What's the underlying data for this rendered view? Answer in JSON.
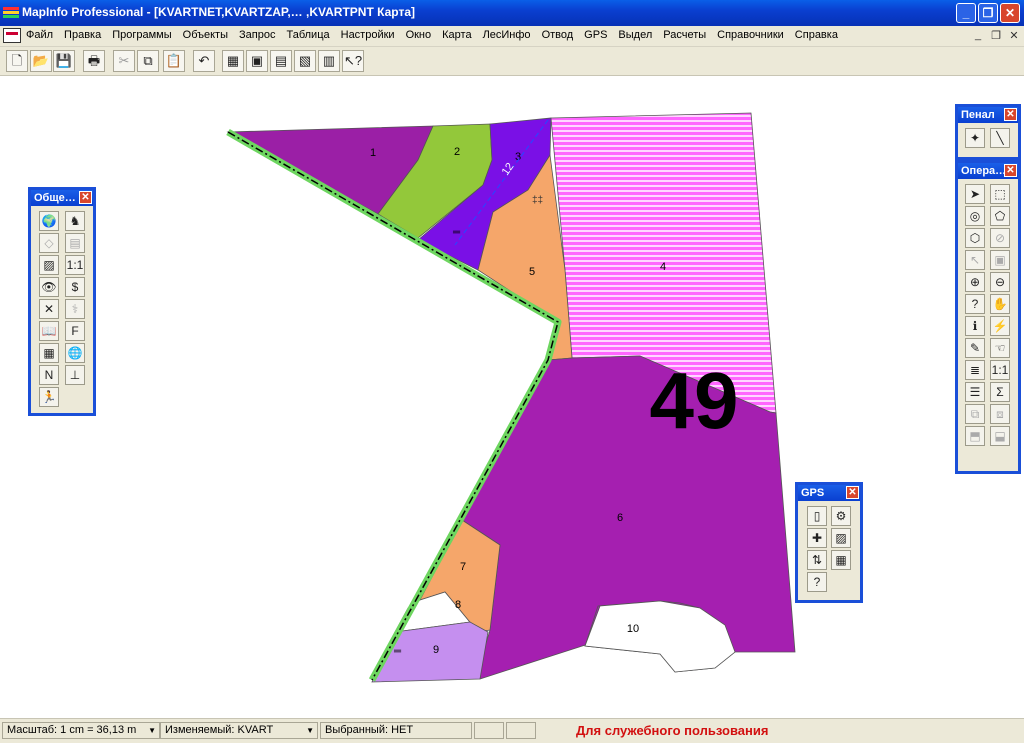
{
  "window": {
    "title": "MapInfo Professional - [KVARTNET,KVARTZAP,… ,KVARTPNT Карта]",
    "minimize": "_",
    "restore": "❐",
    "close": "✕",
    "mdi_minimize": "_",
    "mdi_restore": "❐",
    "mdi_close": "✕"
  },
  "menu": [
    "Файл",
    "Правка",
    "Программы",
    "Объекты",
    "Запрос",
    "Таблица",
    "Настройки",
    "Окно",
    "Карта",
    "ЛесИнфо",
    "Отвод",
    "GPS",
    "Выдел",
    "Расчеты",
    "Справочники",
    "Справка"
  ],
  "toolbar": [
    {
      "name": "new-icon",
      "glyph": "🗋"
    },
    {
      "name": "open-icon",
      "glyph": "📂"
    },
    {
      "name": "save-icon",
      "glyph": "💾"
    },
    {
      "name": "print-icon",
      "glyph": "🖶"
    },
    {
      "name": "cut-icon",
      "glyph": "✂"
    },
    {
      "name": "copy-icon",
      "glyph": "⧉"
    },
    {
      "name": "paste-icon",
      "glyph": "📋"
    },
    {
      "name": "undo-icon",
      "glyph": "↶"
    },
    {
      "name": "new-browser-icon",
      "glyph": "▦"
    },
    {
      "name": "new-mapper-icon",
      "glyph": "▣"
    },
    {
      "name": "new-grapher-icon",
      "glyph": "▤"
    },
    {
      "name": "new-layout-icon",
      "glyph": "▧"
    },
    {
      "name": "new-redistrict-icon",
      "glyph": "▥"
    },
    {
      "name": "help-pointer-icon",
      "glyph": "↖?"
    }
  ],
  "map": {
    "block_number": "49",
    "parcels": [
      {
        "label": "1",
        "fill": "#9b1fa6"
      },
      {
        "label": "2",
        "fill": "#93c83a"
      },
      {
        "label": "3",
        "fill": "#7a10e6"
      },
      {
        "label": "4",
        "fill": "#ff66ff"
      },
      {
        "label": "5",
        "fill": "#f5a66a"
      },
      {
        "label": "6",
        "fill": "#a51fb0"
      },
      {
        "label": "7",
        "fill": "#f5a66a"
      },
      {
        "label": "8",
        "fill": "#ffffff"
      },
      {
        "label": "9",
        "fill": "#c58fef"
      },
      {
        "label": "10",
        "fill": "#ffffff"
      }
    ],
    "road_label": "12",
    "boundary_color": "#6ed660"
  },
  "palettes": {
    "general": {
      "title": "Обще…",
      "buttons": [
        {
          "name": "select-layer-icon",
          "glyph": "🌍"
        },
        {
          "name": "chess-icon",
          "glyph": "♞"
        },
        {
          "name": "diamond-icon",
          "glyph": "◇",
          "dim": true
        },
        {
          "name": "table-dim-icon",
          "glyph": "▤",
          "dim": true
        },
        {
          "name": "map-edit-icon",
          "glyph": "▨"
        },
        {
          "name": "scale-icon",
          "glyph": "1:1"
        },
        {
          "name": "eye-icon",
          "glyph": "👁"
        },
        {
          "name": "dollar-icon",
          "glyph": "$"
        },
        {
          "name": "tools-icon",
          "glyph": "✕"
        },
        {
          "name": "caduceus-icon",
          "glyph": "⚕",
          "dim": true
        },
        {
          "name": "book-icon",
          "glyph": "📖"
        },
        {
          "name": "f-icon",
          "glyph": "F"
        },
        {
          "name": "map-window-icon",
          "glyph": "▦"
        },
        {
          "name": "globe-icon",
          "glyph": "🌐"
        },
        {
          "name": "north-icon",
          "glyph": "N"
        },
        {
          "name": "scalebar-icon",
          "glyph": "⊥"
        },
        {
          "name": "runner-icon",
          "glyph": "🏃"
        }
      ]
    },
    "drawing": {
      "title": "Пенал",
      "buttons": [
        {
          "name": "symbol-icon",
          "glyph": "✦"
        },
        {
          "name": "line-icon",
          "glyph": "╲"
        }
      ]
    },
    "operations": {
      "title": "Опера…",
      "buttons": [
        {
          "name": "select-arrow-icon",
          "glyph": "➤"
        },
        {
          "name": "marquee-select-icon",
          "glyph": "⬚"
        },
        {
          "name": "radius-select-icon",
          "glyph": "◎"
        },
        {
          "name": "polygon-select-icon",
          "glyph": "⬠"
        },
        {
          "name": "boundary-select-icon",
          "glyph": "⬡"
        },
        {
          "name": "unselect-icon",
          "glyph": "⊘",
          "dim": true
        },
        {
          "name": "graph-select-icon",
          "glyph": "↖",
          "dim": true
        },
        {
          "name": "layer-control-select-icon",
          "glyph": "▣",
          "dim": true
        },
        {
          "name": "zoom-in-icon",
          "glyph": "⊕"
        },
        {
          "name": "zoom-out-icon",
          "glyph": "⊖"
        },
        {
          "name": "change-view-icon",
          "glyph": "?"
        },
        {
          "name": "grabber-hand-icon",
          "glyph": "✋"
        },
        {
          "name": "info-icon",
          "glyph": "ℹ"
        },
        {
          "name": "hotlink-icon",
          "glyph": "⚡",
          "dim": true
        },
        {
          "name": "label-icon",
          "glyph": "✎"
        },
        {
          "name": "drag-window-icon",
          "glyph": "☜"
        },
        {
          "name": "layer-control-icon",
          "glyph": "≣"
        },
        {
          "name": "ruler-icon",
          "glyph": "1:1"
        },
        {
          "name": "legend-icon",
          "glyph": "☰"
        },
        {
          "name": "statistics-icon",
          "glyph": "Σ"
        },
        {
          "name": "redistrict-icon",
          "glyph": "⧉",
          "dim": true
        },
        {
          "name": "assign-icon",
          "glyph": "⧈",
          "dim": true
        },
        {
          "name": "clip-region-icon",
          "glyph": "⬒",
          "dim": true
        },
        {
          "name": "clip-off-icon",
          "glyph": "⬓",
          "dim": true
        }
      ]
    },
    "gps": {
      "title": "GPS",
      "buttons": [
        {
          "name": "gps-device-icon",
          "glyph": "▯"
        },
        {
          "name": "gps-settings-icon",
          "glyph": "⚙"
        },
        {
          "name": "gps-add-icon",
          "glyph": "✚"
        },
        {
          "name": "gps-map-icon",
          "glyph": "▨"
        },
        {
          "name": "gps-track-icon",
          "glyph": "⇅"
        },
        {
          "name": "gps-table-icon",
          "glyph": "▦"
        },
        {
          "name": "gps-query-icon",
          "glyph": "?"
        }
      ]
    }
  },
  "status": {
    "scale": "Масштаб: 1 cm = 36,13 m",
    "editable": "Изменяемый: KVART",
    "selected": "Выбранный: НЕТ",
    "note": "Для служебного пользования"
  }
}
